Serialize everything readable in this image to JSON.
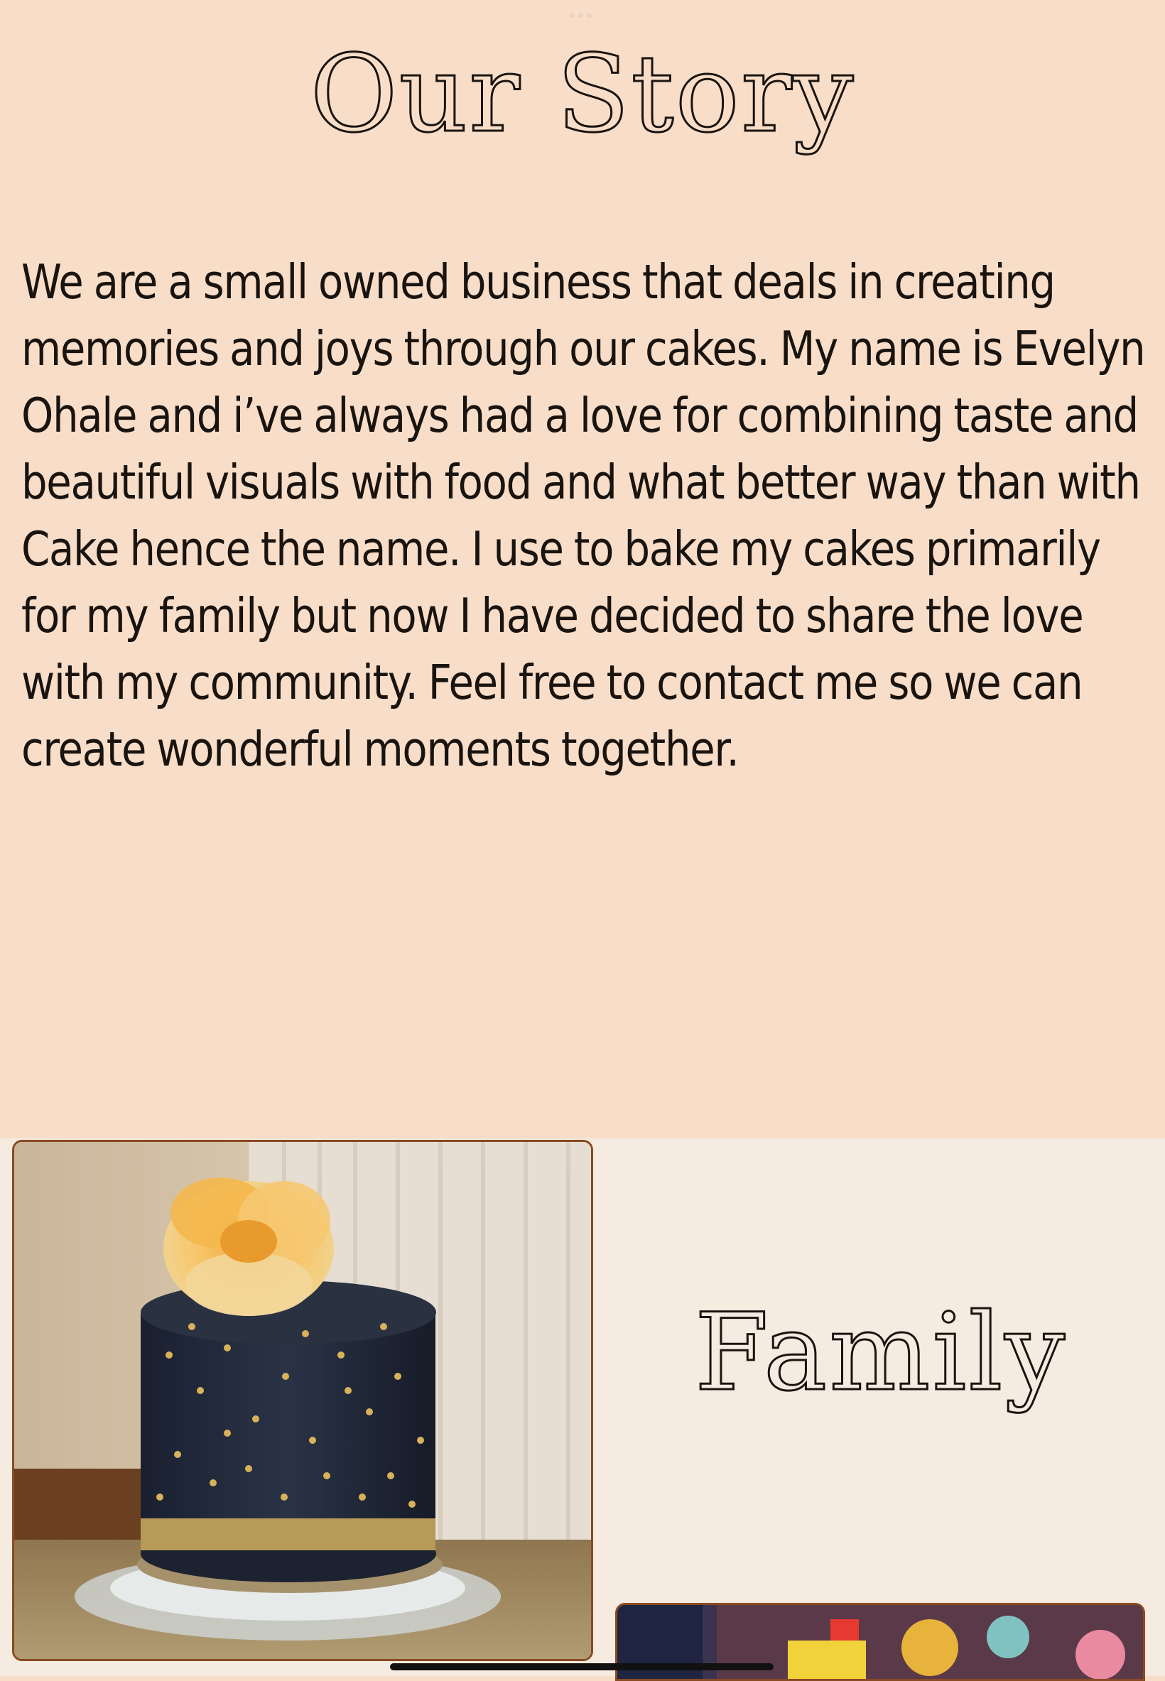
{
  "story": {
    "title": "Our Story",
    "body": "We are a small owned business that deals in creating memories and joys through our cakes. My name is Evelyn Ohale and i’ve always had a love for combining taste and beautiful visuals with food and what better way than with Cake hence the name. I use to bake my cakes primarily for my family but now I have decided to share the love with my community. Feel free to contact me so we can create wonderful moments together."
  },
  "family": {
    "title": "Family"
  },
  "colors": {
    "peach_background": "#f8dec8",
    "cream_background": "#f5ebe0",
    "photo_border": "#8a4a22",
    "text": "#1a1410"
  },
  "icons": [
    "page-dots-icon"
  ]
}
